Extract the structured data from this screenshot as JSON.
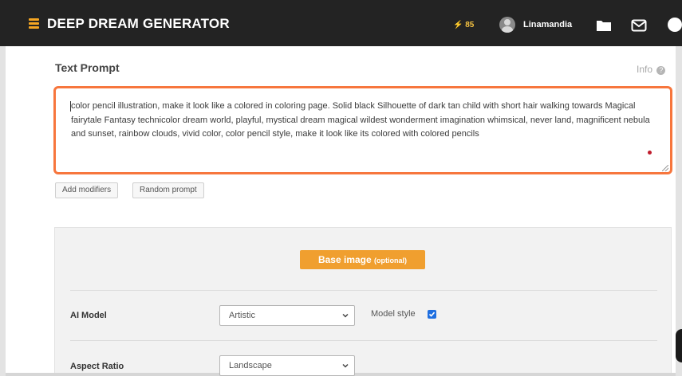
{
  "header": {
    "brand": "DEEP DREAM GENERATOR",
    "energy_count": "85",
    "energy_icon": "⚡",
    "username": "Linamandia",
    "icons": [
      "menu-icon",
      "lightning-icon",
      "avatar",
      "folder-icon",
      "mail-icon",
      "help-icon"
    ]
  },
  "prompt_section": {
    "title": "Text Prompt",
    "info_label": "Info",
    "info_icon": "?",
    "prompt_text": "color pencil illustration, make it look like a colored in coloring page. Solid black Silhouette of dark tan child with short hair walking towards Magical fairytale Fantasy technicolor dream world, playful, mystical dream magical wildest wonderment imagination whimsical, never land,  magnificent nebula and sunset, rainbow clouds, vivid color, color pencil style, make it look like its colored with colored pencils",
    "buttons": {
      "add_modifiers": "Add modifiers",
      "random_prompt": "Random prompt"
    }
  },
  "settings": {
    "base_image_label": "Base image",
    "base_image_suffix": "(optional)",
    "ai_model_label": "AI Model",
    "ai_model_value": "Artistic",
    "model_style_label": "Model style",
    "model_style_checked": true,
    "aspect_ratio_label": "Aspect Ratio",
    "aspect_ratio_value": "Landscape"
  },
  "colors": {
    "topbar": "#232323",
    "accent_orange": "#f09f2f",
    "prompt_border": "#f7763d",
    "checkbox": "#1f6fe0"
  }
}
